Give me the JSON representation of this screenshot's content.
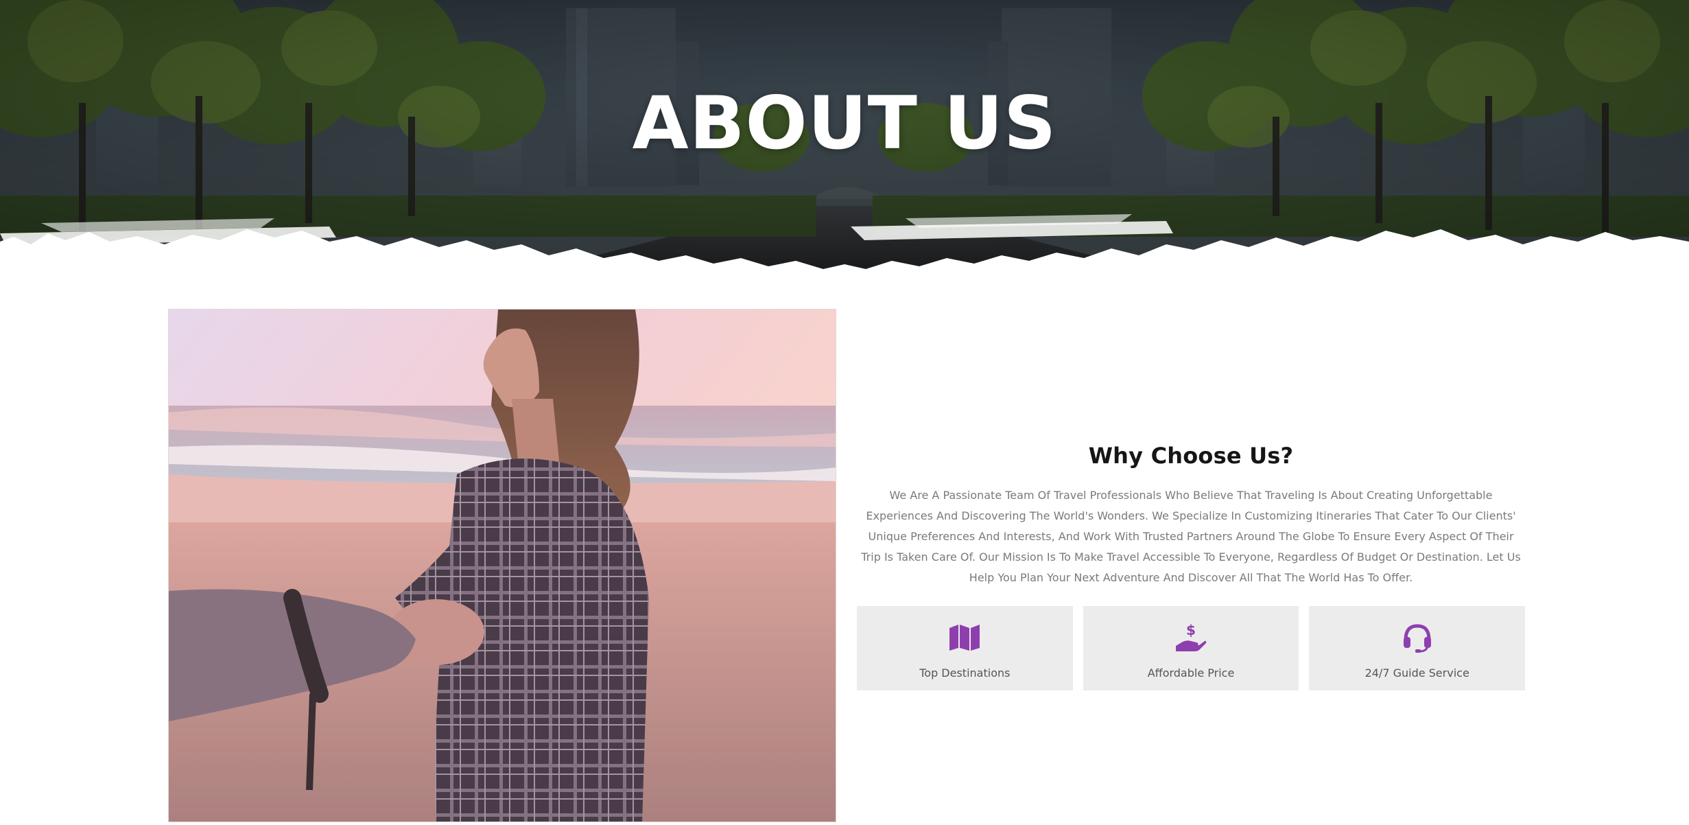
{
  "hero": {
    "title": "ABOUT US"
  },
  "about": {
    "image_alt": "Woman leading a hand along the beach at sunset",
    "heading": "Why Choose Us?",
    "paragraph": "We Are A Passionate Team Of Travel Professionals Who Believe That Traveling Is About Creating Unforgettable Experiences And Discovering The World's Wonders. We Specialize In Customizing Itineraries That Cater To Our Clients' Unique Preferences And Interests, And Work With Trusted Partners Around The Globe To Ensure Every Aspect Of Their Trip Is Taken Care Of. Our Mission Is To Make Travel Accessible To Everyone, Regardless Of Budget Or Destination. Let Us Help You Plan Your Next Adventure And Discover All That The World Has To Offer."
  },
  "features": [
    {
      "label": "Top Destinations",
      "icon": "map-icon"
    },
    {
      "label": "Affordable Price",
      "icon": "hand-dollar-icon"
    },
    {
      "label": "24/7 Guide Service",
      "icon": "headset-icon"
    }
  ],
  "colors": {
    "accent": "#8e3fae",
    "feature_bg": "#ececec",
    "heading": "#161616",
    "body_text": "#7a7a7a"
  }
}
